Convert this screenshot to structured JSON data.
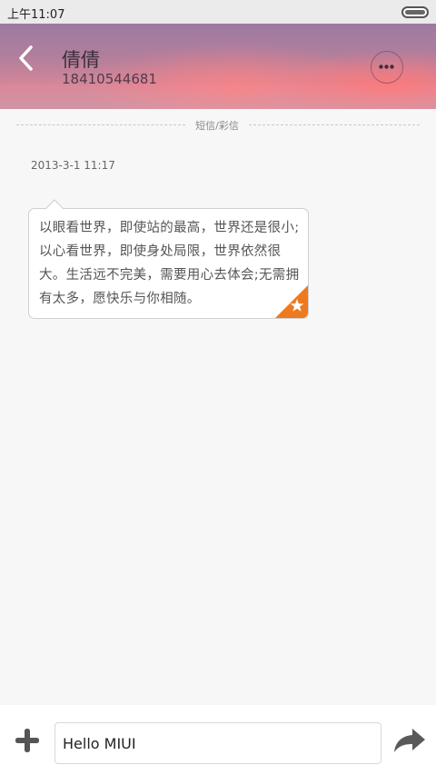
{
  "status_bar": {
    "time": "上午11:07"
  },
  "header": {
    "contact_name": "倩倩",
    "contact_number": "18410544681",
    "back_icon": "chevron-left-icon",
    "more_icon": "more-dots-icon"
  },
  "conversation": {
    "channel_label": "短信/彩信",
    "messages": [
      {
        "timestamp": "2013-3-1 11:17",
        "text": "以眼看世界，即使站的最高，世界还是很小;以心看世界，即使身处局限，世界依然很大。生活远不完美，需要用心去体会;无需拥有太多，愿快乐与你相随。",
        "starred": true
      }
    ]
  },
  "composer": {
    "input_value": "Hello MIUI",
    "attach_icon": "plus-icon",
    "send_icon": "send-arrow-icon"
  },
  "colors": {
    "star_badge": "#ee7a1f",
    "status_bar_bg": "#ebebeb",
    "page_bg": "#f7f7f7"
  }
}
